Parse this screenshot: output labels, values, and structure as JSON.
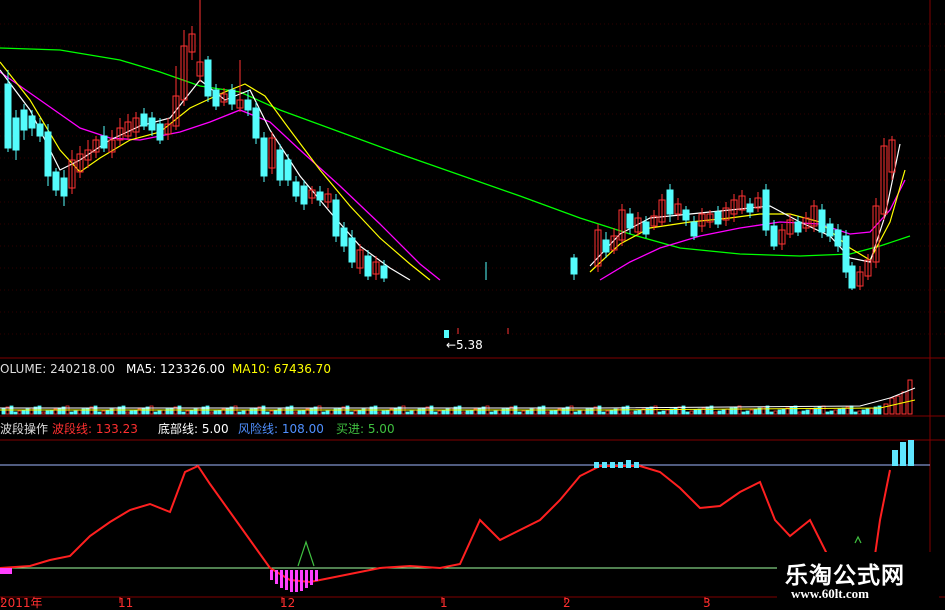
{
  "colors": {
    "up": "#ff3232",
    "down": "#54fcfc",
    "ma5": "#ffffff",
    "ma10": "#ffff00",
    "ma20": "#ff00ff",
    "ma60": "#00ff00",
    "panel_border": "#800000",
    "wave": "#ff2020",
    "bottom_line": "#ffffff",
    "risk_line": "#6090ff",
    "buy_line": "#40c040",
    "magenta_bar": "#ff40ff"
  },
  "main": {
    "low_marker_label": "←5.38"
  },
  "volume_panel": {
    "label_volume": "OLUME: 240218.00",
    "label_ma5": "MA5: 123326.00",
    "label_ma10": "MA10: 67436.70"
  },
  "indicator_panel": {
    "label_name": "波段操作",
    "label_wave": "波段线: 133.23",
    "label_bottom": "底部线: 5.00",
    "label_risk": "风险线: 108.00",
    "label_buy": "买进: 5.00"
  },
  "time_axis": {
    "ticks": [
      "2011年",
      "11",
      "12",
      "1",
      "2",
      "3"
    ]
  },
  "watermark": {
    "title": "乐淘公式网",
    "url": "www.60lt.com"
  },
  "chart_data": [
    {
      "type": "candlestick",
      "title": "",
      "low_marker": 5.38,
      "series": [
        {
          "name": "MA5",
          "color": "#ffffff"
        },
        {
          "name": "MA10",
          "color": "#ffff00"
        },
        {
          "name": "MA20",
          "color": "#ff00ff"
        },
        {
          "name": "MA60",
          "color": "#00ff00"
        }
      ]
    },
    {
      "type": "bar",
      "title": "VOLUME",
      "values_shown": {
        "VOLUME": 240218.0,
        "MA5": 123326.0,
        "MA10": 67436.7
      }
    },
    {
      "type": "line",
      "title": "波段操作",
      "values_shown": {
        "波段线": 133.23,
        "底部线": 5.0,
        "风险线": 108.0,
        "买进": 5.0
      }
    }
  ]
}
